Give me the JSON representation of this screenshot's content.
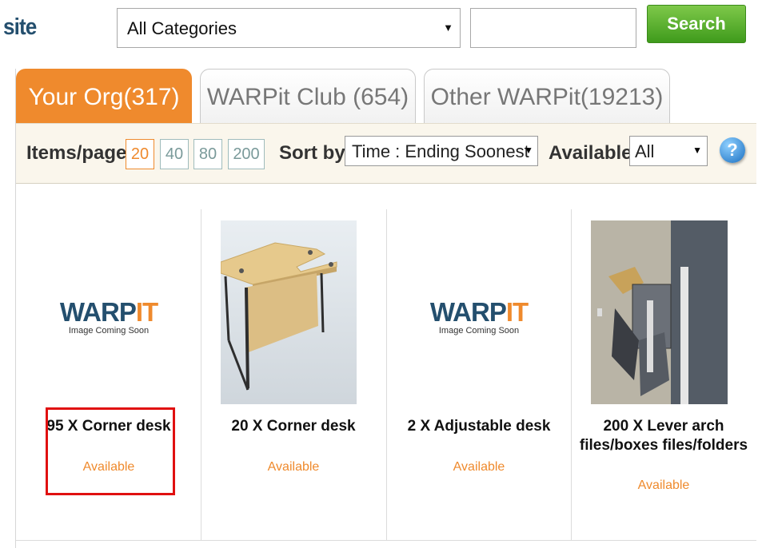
{
  "header": {
    "site_label": "site",
    "category_select": "All Categories",
    "search_value": "",
    "search_button": "Search"
  },
  "tabs": [
    {
      "label": "Your Org(317)",
      "active": true
    },
    {
      "label": "WARPit Club (654)",
      "active": false
    },
    {
      "label": "Other WARPit(19213)",
      "active": false
    }
  ],
  "toolbar": {
    "items_per_page_label": "Items/page",
    "page_sizes": [
      "20",
      "40",
      "80",
      "200"
    ],
    "selected_page_size": "20",
    "sort_label": "Sort by",
    "sort_value": "Time : Ending Soonest",
    "available_label": "Available",
    "available_value": "All",
    "help_glyph": "?"
  },
  "placeholder": {
    "logo_main": "WARP",
    "logo_accent": "IT",
    "caption": "Image Coming Soon"
  },
  "items": [
    {
      "title": "95 X Corner desk",
      "status": "Available",
      "image": "placeholder"
    },
    {
      "title": "20 X Corner desk",
      "status": "Available",
      "image": "desk-photo"
    },
    {
      "title": "2 X Adjustable desk",
      "status": "Available",
      "image": "placeholder"
    },
    {
      "title_line1": "200 X Lever arch",
      "title_line2": "files/boxes files/folders",
      "status": "Available",
      "image": "files-photo"
    }
  ],
  "colors": {
    "accent": "#ef8a2d",
    "brand": "#244f6e",
    "search_green": "#4ea62a",
    "highlight": "#e01010"
  }
}
